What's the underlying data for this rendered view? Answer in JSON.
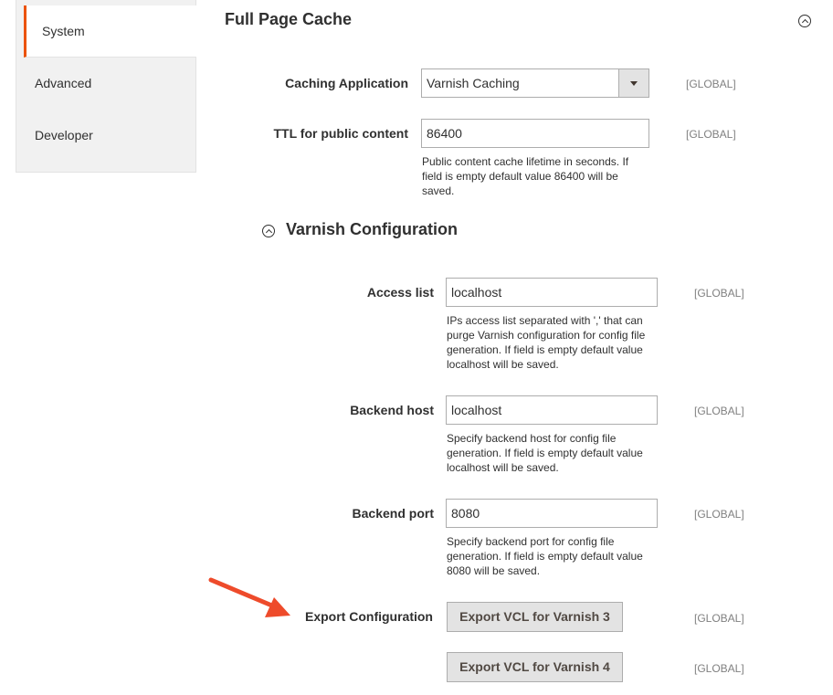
{
  "sidebar": {
    "items": [
      {
        "label": "System",
        "active": true
      },
      {
        "label": "Advanced",
        "active": false
      },
      {
        "label": "Developer",
        "active": false
      }
    ]
  },
  "section": {
    "title": "Full Page Cache",
    "collapse_icon": "chevron-up-circle-icon"
  },
  "fields": {
    "caching_application": {
      "label": "Caching Application",
      "value": "Varnish Caching",
      "scope": "[GLOBAL]"
    },
    "ttl": {
      "label": "TTL for public content",
      "value": "86400",
      "note": "Public content cache lifetime in seconds. If field is empty default value 86400 will be saved.",
      "scope": "[GLOBAL]"
    }
  },
  "varnish": {
    "title": "Varnish Configuration",
    "access_list": {
      "label": "Access list",
      "value": "localhost",
      "note": "IPs access list separated with ',' that can purge Varnish configuration for config file generation. If field is empty default value localhost will be saved.",
      "scope": "[GLOBAL]"
    },
    "backend_host": {
      "label": "Backend host",
      "value": "localhost",
      "note": "Specify backend host for config file generation. If field is empty default value localhost will be saved.",
      "scope": "[GLOBAL]"
    },
    "backend_port": {
      "label": "Backend port",
      "value": "8080",
      "note": "Specify backend port for config file generation. If field is empty default value 8080 will be saved.",
      "scope": "[GLOBAL]"
    },
    "export": {
      "label": "Export Configuration",
      "button3": "Export VCL for Varnish 3",
      "button4": "Export VCL for Varnish 4",
      "scope3": "[GLOBAL]",
      "scope4": "[GLOBAL]"
    }
  },
  "annotation": {
    "arrow_color": "#ee4b2b"
  },
  "colors": {
    "accent": "#eb5202",
    "scope_text": "#808080",
    "button_bg": "#e3e3e3"
  }
}
